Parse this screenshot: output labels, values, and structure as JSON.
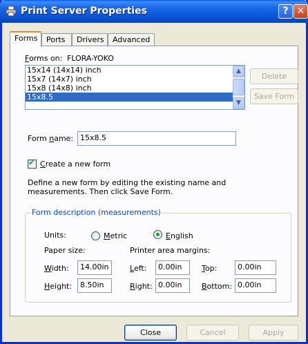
{
  "window": {
    "title": "Print Server Properties"
  },
  "tabs": [
    "Forms",
    "Ports",
    "Drivers",
    "Advanced"
  ],
  "forms_on": {
    "label": "Forms on:",
    "server": "FLORA-YOKO"
  },
  "forms_list": [
    "15x14 (14x14) inch",
    "15x7 (14x7) inch",
    "15x8 (14x8) inch",
    "15x8.5"
  ],
  "buttons": {
    "delete": "Delete",
    "save_form": "Save Form",
    "close": "Close",
    "cancel": "Cancel",
    "apply": "Apply"
  },
  "form_name": {
    "label": "Form name:",
    "value": "15x8.5"
  },
  "create_new": {
    "label": "Create a new form",
    "checked": true
  },
  "info_text": [
    "Define a new form by editing the existing name and",
    "measurements.  Then click Save Form."
  ],
  "form_description": {
    "title": "Form description (measurements)",
    "units_label": "Units:",
    "metric": "Metric",
    "english": "English",
    "selected_unit": "English",
    "paper_size_label": "Paper size:",
    "margins_label": "Printer area margins:",
    "width_label": "Width:",
    "width_value": "14.00in",
    "height_label": "Height:",
    "height_value": "8.50in",
    "left_label": "Left:",
    "left_value": "0.00in",
    "right_label": "Right:",
    "right_value": "0.00in",
    "top_label": "Top:",
    "top_value": "0.00in",
    "bottom_label": "Bottom:",
    "bottom_value": "0.00in"
  }
}
